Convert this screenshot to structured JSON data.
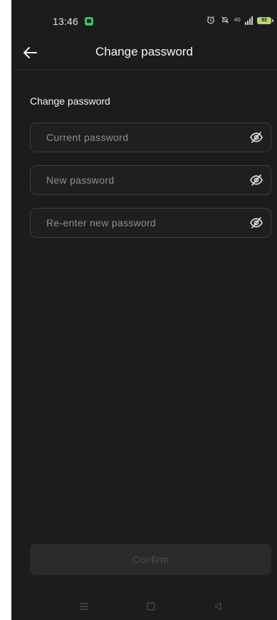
{
  "status_bar": {
    "time": "13:46",
    "network": "4G",
    "battery": "92"
  },
  "header": {
    "title": "Change password"
  },
  "form": {
    "section_title": "Change password",
    "fields": [
      {
        "placeholder": "Current password",
        "value": ""
      },
      {
        "placeholder": "New password",
        "value": ""
      },
      {
        "placeholder": "Re-enter new password",
        "value": ""
      }
    ],
    "confirm_label": "Confirm"
  },
  "icons": {
    "back": "arrow-left-icon",
    "password_toggle": "eye-off-icon",
    "nav_menu": "menu-icon",
    "nav_home": "home-square-icon",
    "nav_back": "triangle-back-icon"
  },
  "colors": {
    "background": "#1c1c1e",
    "field_border": "#3e3e42",
    "placeholder": "#8e8e93",
    "confirm_disabled_bg": "#2a2a2c",
    "confirm_disabled_text": "#4e4e52",
    "battery": "#b5d86a"
  }
}
